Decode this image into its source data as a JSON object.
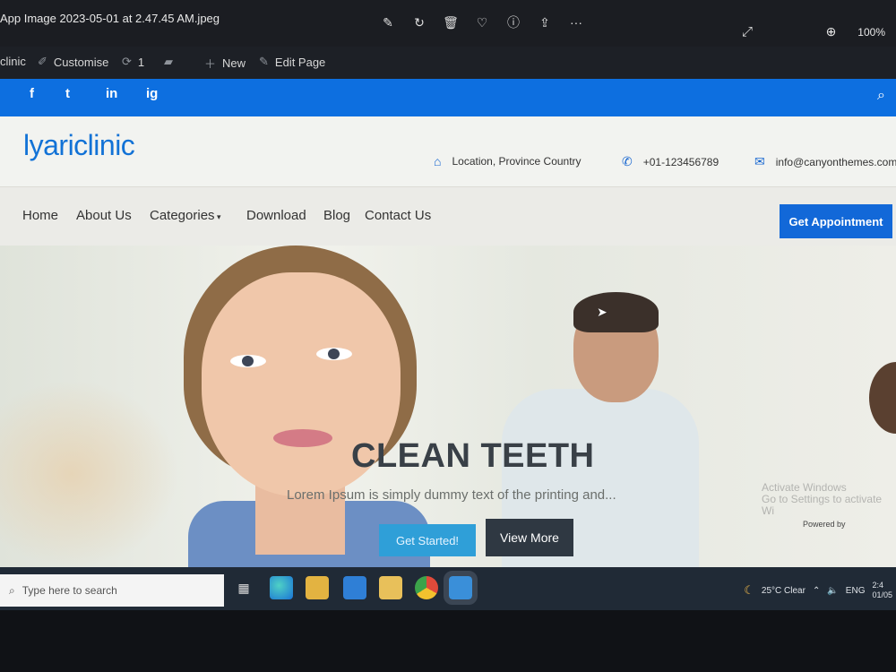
{
  "viewer": {
    "title": "App Image 2023-05-01 at 2.47.45 AM.jpeg",
    "tools": [
      "edit-icon",
      "rotate-icon",
      "delete-icon",
      "favorite-icon",
      "info-icon",
      "share-icon",
      "more-icon"
    ],
    "zoom": "100%"
  },
  "admin_bar": {
    "site": "clinic",
    "customise": "Customise",
    "updates": "1",
    "new": "New",
    "edit_page": "Edit Page"
  },
  "social": [
    "f",
    "t",
    "in",
    "ig"
  ],
  "header": {
    "logo": "lyariclinic",
    "location": "Location, Province Country",
    "phone": "+01-123456789",
    "email": "info@canyonthemes.com"
  },
  "nav": {
    "items": [
      "Home",
      "About Us",
      "Categories",
      "Download",
      "Blog",
      "Contact Us"
    ],
    "cta": "Get Appointment"
  },
  "hero": {
    "title": "CLEAN TEETH",
    "subtitle": "Lorem Ipsum is simply dummy text of the printing and...",
    "btn_primary": "Get Started!",
    "btn_secondary": "View More",
    "watermark_line1": "Activate Windows",
    "watermark_line2": "Go to Settings to activate Wi",
    "powered": "Powered by"
  },
  "taskbar": {
    "search_placeholder": "Type here to search",
    "weather": "25°C Clear",
    "lang": "ENG",
    "time": "2:4",
    "date": "01/05"
  },
  "colors": {
    "brand_blue": "#0d6fe0",
    "appt_blue": "#1268d8",
    "dark_button": "#2f3842"
  }
}
